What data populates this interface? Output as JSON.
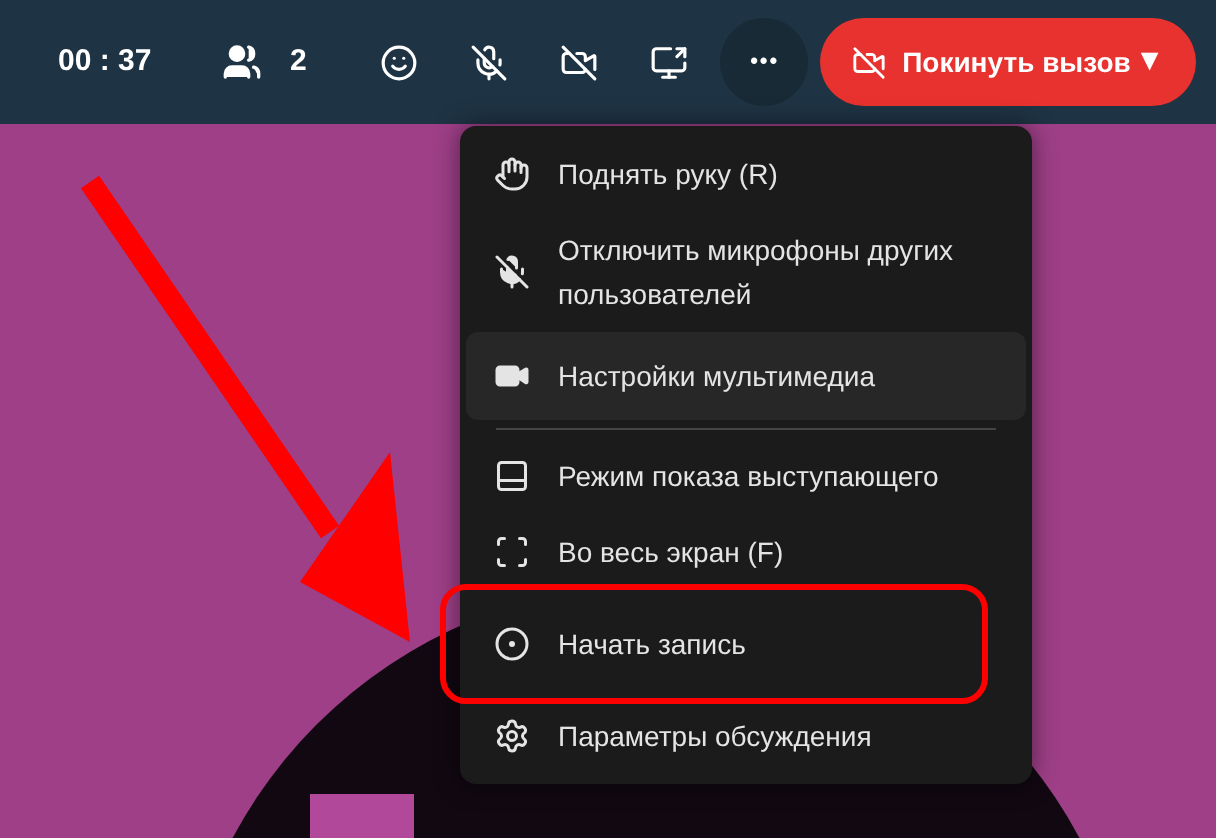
{
  "toolbar": {
    "timer": "00 : 37",
    "participants_count": "2",
    "buttons": [
      {
        "kind": "reactions"
      },
      {
        "kind": "mic_off"
      },
      {
        "kind": "camera_off"
      },
      {
        "kind": "share"
      }
    ],
    "more_button": {
      "label": "•••",
      "active": true
    },
    "leave_button": {
      "label": "Покинуть вызов",
      "caret": "▼"
    }
  },
  "menu": {
    "items": [
      {
        "kind": "hand",
        "label": "Поднять руку (R)",
        "highlighted": false,
        "outlined": false,
        "divider_after": false
      },
      {
        "kind": "mute_others",
        "label": "Отключить микрофоны других пользователей",
        "highlighted": false,
        "outlined": false,
        "divider_after": false
      },
      {
        "kind": "media",
        "label": "Настройки мультимедиа",
        "highlighted": true,
        "outlined": false,
        "divider_after": true
      },
      {
        "kind": "presenter",
        "label": "Режим показа выступающего",
        "highlighted": false,
        "outlined": false,
        "divider_after": false
      },
      {
        "kind": "fullscreen",
        "label": "Во весь экран (F)",
        "highlighted": false,
        "outlined": false,
        "divider_after": false
      },
      {
        "kind": "record",
        "label": "Начать запись",
        "highlighted": false,
        "outlined": true,
        "divider_after": false
      },
      {
        "kind": "settings",
        "label": "Параметры обсуждения",
        "highlighted": false,
        "outlined": false,
        "divider_after": false
      }
    ]
  }
}
